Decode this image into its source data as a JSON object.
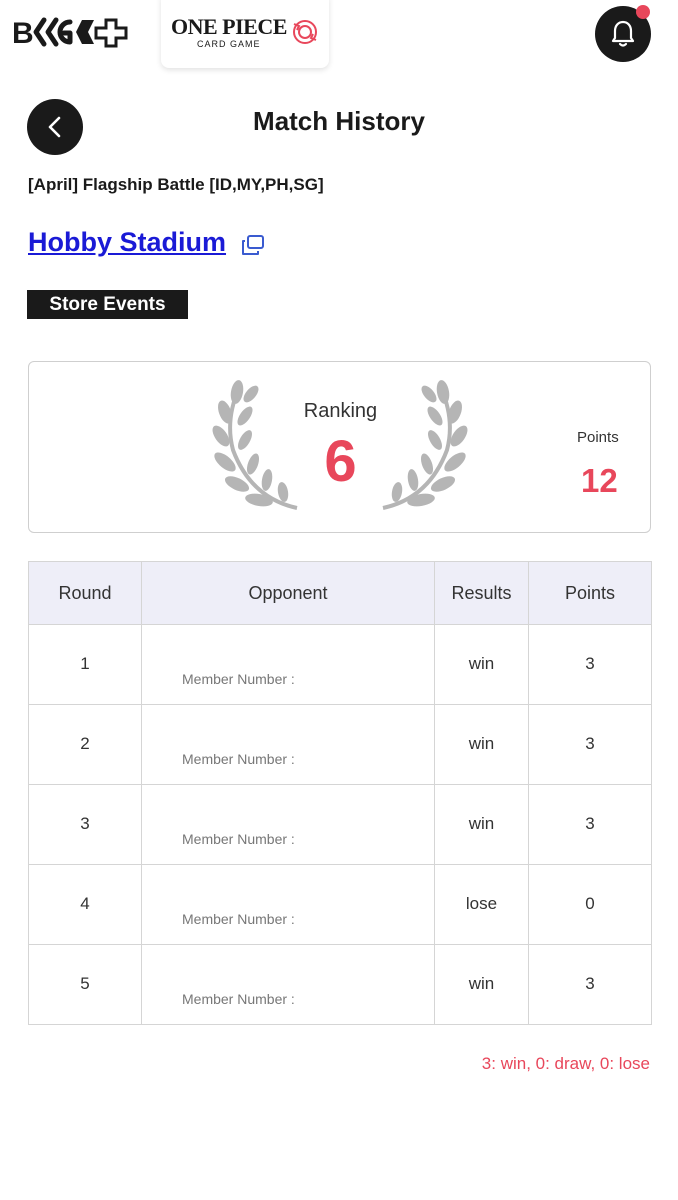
{
  "topbar": {
    "logo_text": "B.TCG+",
    "game_title": "ONE PIECE",
    "game_subtitle": "CARD GAME"
  },
  "header": {
    "title": "Match History"
  },
  "event": {
    "name": "[April] Flagship Battle [ID,MY,PH,SG]",
    "store": "Hobby Stadium",
    "badge": "Store Events"
  },
  "summary": {
    "ranking_label": "Ranking",
    "ranking_value": "6",
    "points_label": "Points",
    "points_value": "12"
  },
  "table": {
    "headers": [
      "Round",
      "Opponent",
      "Results",
      "Points"
    ],
    "member_label": "Member Number :",
    "rows": [
      {
        "round": "1",
        "result": "win",
        "points": "3"
      },
      {
        "round": "2",
        "result": "win",
        "points": "3"
      },
      {
        "round": "3",
        "result": "win",
        "points": "3"
      },
      {
        "round": "4",
        "result": "lose",
        "points": "0"
      },
      {
        "round": "5",
        "result": "win",
        "points": "3"
      }
    ]
  },
  "legend": "3: win, 0: draw, 0: lose",
  "colors": {
    "accent": "#e8475b",
    "link": "#1a1ad6",
    "dark": "#1a1a1a",
    "table_header_bg": "#eeeef8"
  }
}
